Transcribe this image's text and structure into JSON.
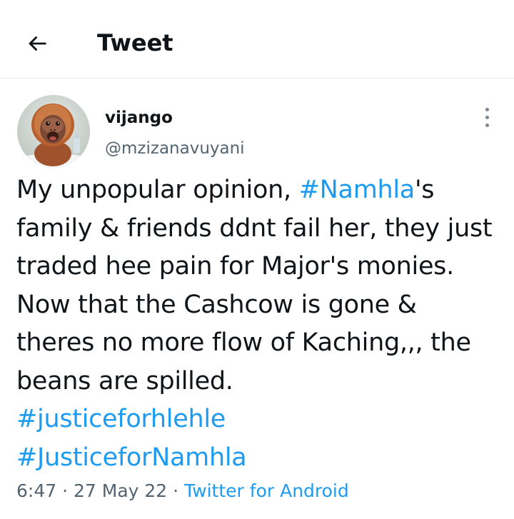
{
  "header": {
    "title": "Tweet",
    "back_icon": "arrow-left-icon"
  },
  "author": {
    "display_name": "vijango",
    "handle": "@mzizanavuyani",
    "avatar_icon": "orangutan-avatar"
  },
  "tweet": {
    "segments": {
      "s1": "My unpopular opinion, ",
      "h1": "#Namhla",
      "s2": "'s family & friends ddnt fail her, they just traded hee pain for Major's monies. Now that the Cashcow is gone & theres no more flow of Kaching,,, the beans are spilled.",
      "h2": "#justiceforhlehle",
      "h3": "#JusticeforNamhla"
    }
  },
  "meta": {
    "time": "6:47",
    "sep1": " · ",
    "date": "27 May 22",
    "sep2": " · ",
    "source": "Twitter for Android"
  },
  "colors": {
    "link": "#1d9bf0",
    "secondary_text": "#536471",
    "primary_text": "#0f1419",
    "divider": "#e6e9ec"
  },
  "more_icon": "more-vertical-icon"
}
